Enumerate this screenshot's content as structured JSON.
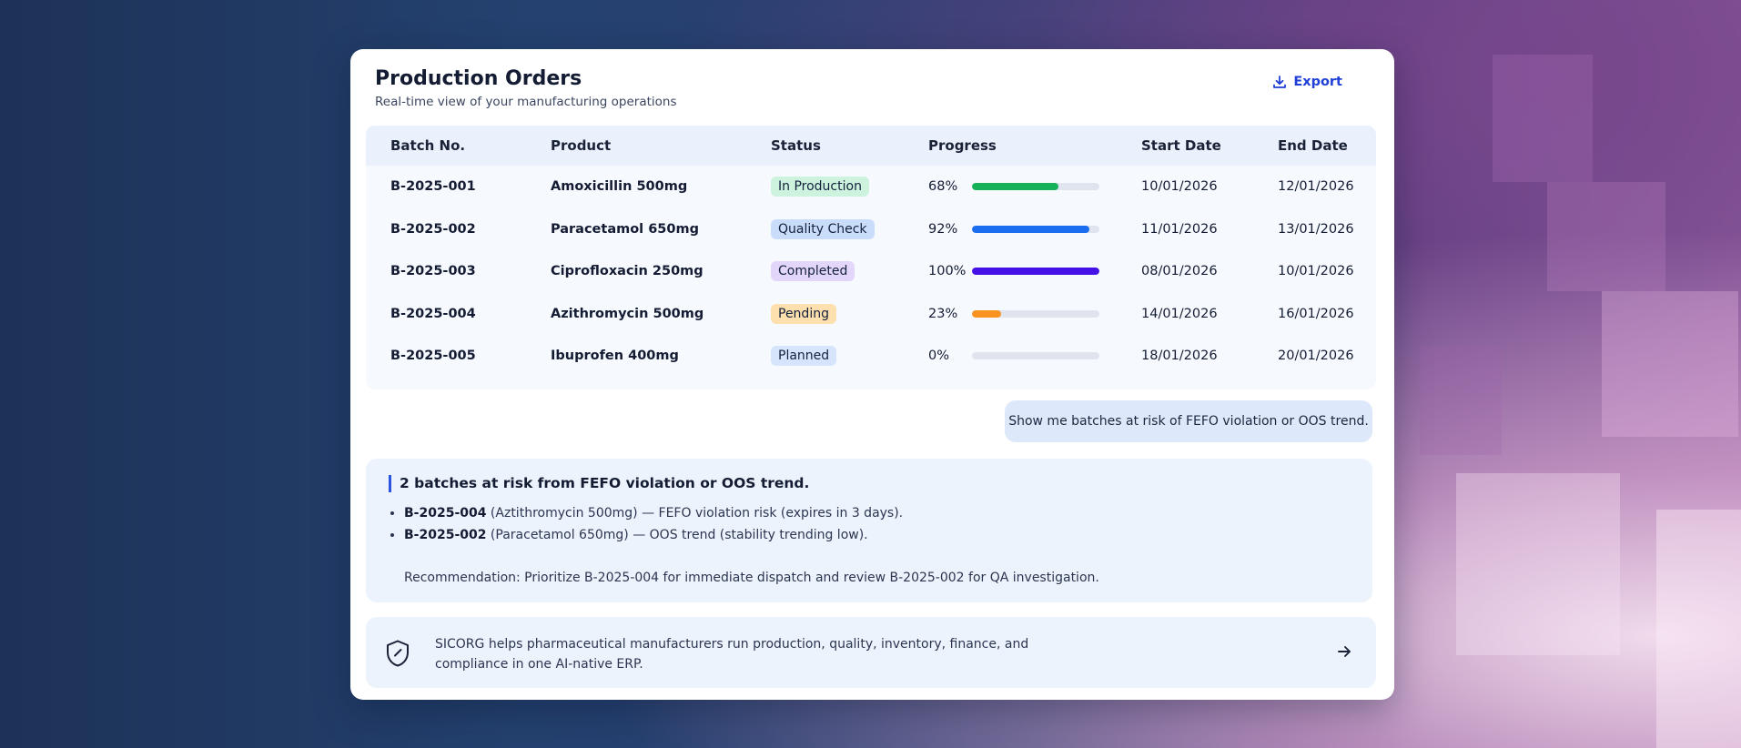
{
  "header": {
    "title": "Production Orders",
    "subtitle": "Real-time view of your manufacturing operations",
    "export_label": "Export"
  },
  "table": {
    "columns": [
      "Batch No.",
      "Product",
      "Status",
      "Progress",
      "Start Date",
      "End Date"
    ],
    "rows": [
      {
        "batch": "B-2025-001",
        "product": "Amoxicillin 500mg",
        "status": "In Production",
        "progress": "68%",
        "progress_value": 68,
        "start": "10/01/2026",
        "end": "12/01/2026"
      },
      {
        "batch": "B-2025-002",
        "product": "Paracetamol 650mg",
        "status": "Quality Check",
        "progress": "92%",
        "progress_value": 92,
        "start": "11/01/2026",
        "end": "13/01/2026"
      },
      {
        "batch": "B-2025-003",
        "product": "Ciprofloxacin 250mg",
        "status": "Completed",
        "progress": "100%",
        "progress_value": 100,
        "start": "08/01/2026",
        "end": "10/01/2026"
      },
      {
        "batch": "B-2025-004",
        "product": "Azithromycin 500mg",
        "status": "Pending",
        "progress": "23%",
        "progress_value": 23,
        "start": "14/01/2026",
        "end": "16/01/2026"
      },
      {
        "batch": "B-2025-005",
        "product": "Ibuprofen 400mg",
        "status": "Planned",
        "progress": "0%",
        "progress_value": 0,
        "start": "18/01/2026",
        "end": "20/01/2026"
      }
    ]
  },
  "status_colors": {
    "In Production": {
      "bg": "#cdf3df",
      "bar": "#16b25a"
    },
    "Quality Check": {
      "bg": "#c9ddfb",
      "bar": "#1c6ef0"
    },
    "Completed": {
      "bg": "#e2d6fb",
      "bar": "#4412e6"
    },
    "Pending": {
      "bg": "#fde0ad",
      "bar": "#f7931e"
    },
    "Planned": {
      "bg": "#d6e5fb",
      "bar": "#9aa6bd"
    }
  },
  "chat": {
    "query": "Show me batches at risk of FEFO violation or OOS trend.",
    "answer_title": "2 batches at risk from FEFO violation or OOS trend.",
    "items": [
      {
        "batch": "B-2025-004",
        "detail": " (Aztithromycin 500mg)  — FEFO violation risk (expires in 3 days)."
      },
      {
        "batch": "B-2025-002",
        "detail": " (Paracetamol 650mg) — OOS trend (stability trending low)."
      }
    ],
    "recommendation": "Recommendation: Prioritize B-2025-004 for immediate dispatch and review B-2025-002 for QA investigation."
  },
  "footer": {
    "text": "SICORG helps pharmaceutical manufacturers run production, quality, inventory, finance, and compliance in one AI-native ERP.",
    "shield_icon": "shield-check-icon",
    "arrow_icon": "arrow-right-icon"
  }
}
